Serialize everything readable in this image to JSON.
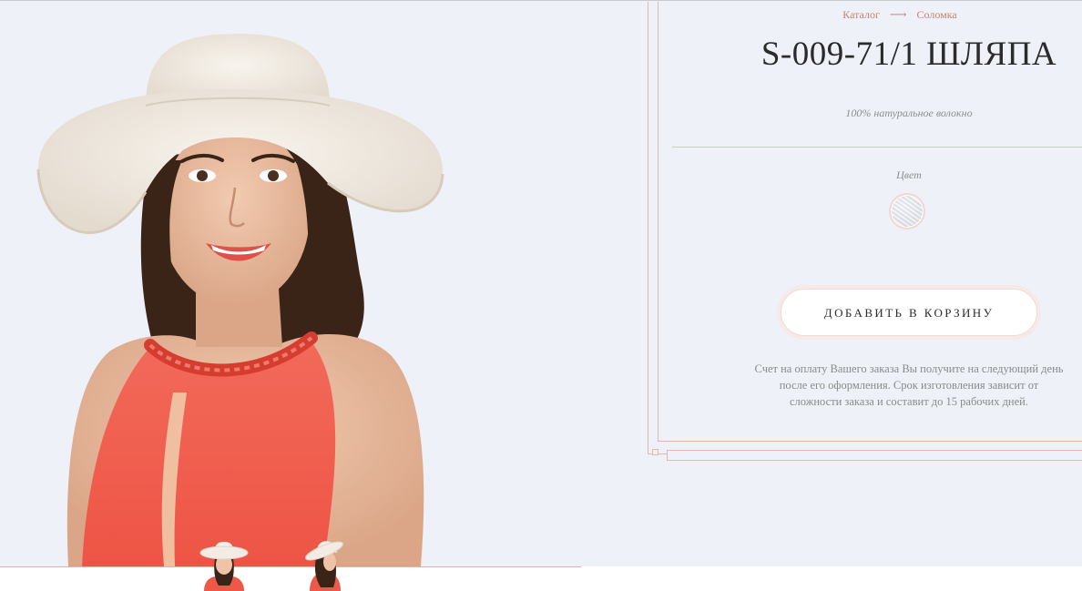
{
  "breadcrumb": {
    "items": [
      "Каталог",
      "Соломка"
    ],
    "separator": "⟶"
  },
  "product": {
    "title": "S-009-71/1 ШЛЯПА",
    "material": "100% натуральное волокно",
    "color_label": "Цвет",
    "color_options": [
      {
        "name": "white-straw"
      }
    ],
    "add_to_cart": "ДОБАВИТЬ В КОРЗИНУ",
    "note": "Счет на оплату Вашего заказа Вы получите на следующий день после его оформления. Срок изготовления зависит от сложности заказа и составит до 15 рабочих дней."
  },
  "gallery": {
    "thumbnails": [
      "front-view",
      "side-view"
    ]
  },
  "colors": {
    "background": "#eef2f8",
    "accent": "#c8816c",
    "frame": "#e3b8ad",
    "dress": "#f0584a",
    "hat": "#efe9e1"
  }
}
